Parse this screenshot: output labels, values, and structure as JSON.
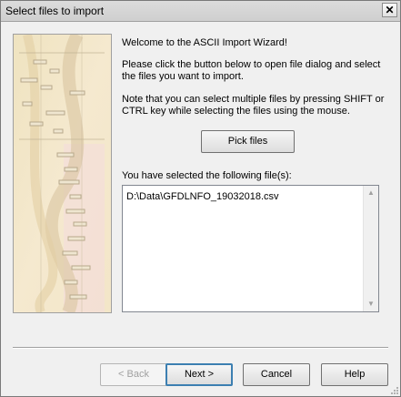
{
  "window": {
    "title": "Select files to import",
    "close_icon": "close-icon"
  },
  "content": {
    "welcome": "Welcome to the ASCII Import Wizard!",
    "instruction_line1": "Please click the button below to open file dialog and select",
    "instruction_line2": "the files you want to import.",
    "note_line1": "Note that you can select multiple files by pressing SHIFT or",
    "note_line2": "CTRL key while selecting the files using the mouse.",
    "pick_files_label": "Pick files",
    "selected_label": "You have selected the following file(s):",
    "selected_files": [
      "D:\\Data\\GFDLNFO_19032018.csv"
    ]
  },
  "buttons": {
    "back": "< Back",
    "next": "Next >",
    "cancel": "Cancel",
    "help": "Help"
  },
  "colors": {
    "dialog_bg": "#f0f0f0",
    "default_button_border": "#3c7fb1",
    "disabled_text": "#a0a0a0"
  }
}
